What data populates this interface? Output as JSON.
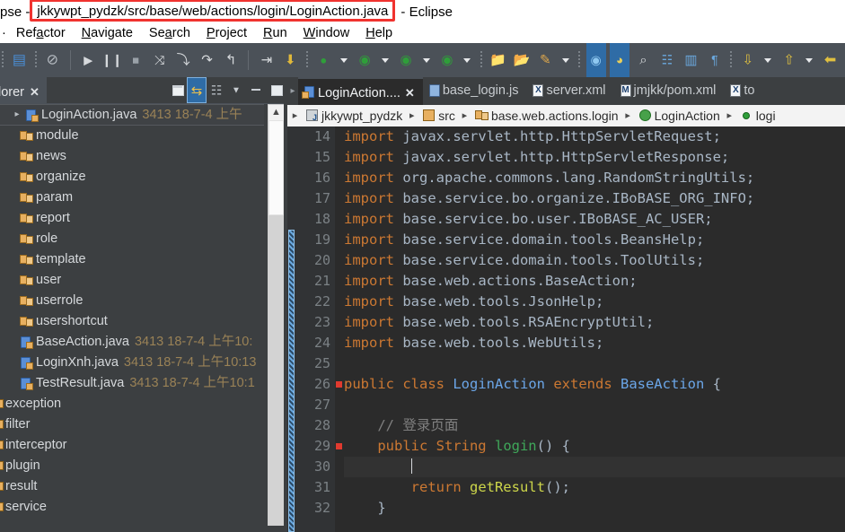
{
  "window": {
    "title_prefix": "pse -",
    "title_highlighted": "jkkywpt_pydzk/src/base/web/actions/login/LoginAction.java",
    "title_suffix": "- Eclipse",
    "highlight_color": "#f0332f"
  },
  "menubar": {
    "items": [
      {
        "pre": "",
        "mn": "",
        "post": "·"
      },
      {
        "pre": "Ref",
        "mn": "a",
        "post": "ctor"
      },
      {
        "pre": "",
        "mn": "N",
        "post": "avigate"
      },
      {
        "pre": "Se",
        "mn": "a",
        "post": "rch"
      },
      {
        "pre": "",
        "mn": "P",
        "post": "roject"
      },
      {
        "pre": "",
        "mn": "R",
        "post": "un"
      },
      {
        "pre": "",
        "mn": "W",
        "post": "indow"
      },
      {
        "pre": "",
        "mn": "H",
        "post": "elp"
      }
    ]
  },
  "toolbar": {
    "groups": [
      {
        "name": "save-group",
        "buttons": [
          {
            "name": "save-icon",
            "glyph": "▤",
            "color": "#3b7dbf",
            "selected": false
          },
          {
            "name": "save-all-icon",
            "glyph": "⊘",
            "color": "#c9ced3",
            "selected": false
          }
        ]
      },
      {
        "name": "debug-group",
        "buttons": [
          {
            "name": "resume-icon",
            "glyph": "▶",
            "color": "#c9ced3"
          },
          {
            "name": "suspend-icon",
            "glyph": "❙❙",
            "color": "#c9ced3"
          },
          {
            "name": "terminate-icon",
            "glyph": "■",
            "color": "#a8aeb4"
          },
          {
            "name": "disconnect-icon",
            "glyph": "⤨",
            "color": "#c9ced3"
          },
          {
            "name": "step-into-icon",
            "glyph": "⤵",
            "color": "#c9ced3"
          },
          {
            "name": "step-over-icon",
            "glyph": "↷",
            "color": "#c9ced3"
          },
          {
            "name": "step-return-icon",
            "glyph": "↰",
            "color": "#c9ced3"
          }
        ]
      },
      {
        "name": "build-group",
        "buttons": [
          {
            "name": "build-all-icon",
            "glyph": "⇥",
            "color": "#e8eaec"
          },
          {
            "name": "toggle-breakpoint-icon",
            "glyph": "⬇",
            "color": "#e0b83a"
          }
        ]
      },
      {
        "name": "run-group",
        "buttons": [
          {
            "name": "skip-breakpoints-icon",
            "glyph": "●",
            "color": "#2f9e3a"
          },
          {
            "name": "run-icon",
            "glyph": "▶",
            "color": "#2f9e3a"
          },
          {
            "name": "debug-icon",
            "glyph": "●",
            "color": "#2f9e3a"
          },
          {
            "name": "coverage-icon",
            "glyph": "●",
            "color": "#2f9e3a"
          }
        ]
      },
      {
        "name": "open-group",
        "buttons": [
          {
            "name": "new-java-project-icon",
            "glyph": "📁",
            "color": "#e8b060"
          },
          {
            "name": "open-folder-icon",
            "glyph": "📂",
            "color": "#e8b060"
          },
          {
            "name": "new-icon",
            "glyph": "✎",
            "color": "#e8b060"
          }
        ]
      },
      {
        "name": "perspective-group",
        "buttons": [
          {
            "name": "java-perspective-icon",
            "glyph": "◉",
            "color": "#5b9bd5",
            "selected": true
          },
          {
            "name": "javascript-perspective-icon",
            "glyph": "◗",
            "color": "#e0c040",
            "selected": true
          },
          {
            "name": "search-icon",
            "glyph": "⌕",
            "color": "#c9ced3"
          },
          {
            "name": "open-task-icon",
            "glyph": "☷",
            "color": "#5b9bd5"
          },
          {
            "name": "open-type-icon",
            "glyph": "▥",
            "color": "#5b9bd5"
          },
          {
            "name": "last-edit-icon",
            "glyph": "¶",
            "color": "#5b9bd5"
          }
        ]
      },
      {
        "name": "nav-group",
        "buttons": [
          {
            "name": "next-annotation-icon",
            "glyph": "↓",
            "color": "#e0c040"
          },
          {
            "name": "previous-annotation-icon",
            "glyph": "↑",
            "color": "#e0c040"
          },
          {
            "name": "back-icon",
            "glyph": "⇦",
            "color": "#e0c040"
          },
          {
            "name": "forward-back-icon",
            "glyph": "⇦",
            "color": "#e0c040"
          },
          {
            "name": "forward-icon",
            "glyph": "⇨",
            "color": "#e8eaec"
          }
        ]
      }
    ]
  },
  "explorer": {
    "tab_label": "lorer",
    "tab_close": "✕",
    "tools": [
      {
        "name": "collapse-all-icon",
        "glyph": "⊟",
        "active": false
      },
      {
        "name": "link-with-editor-icon",
        "glyph": "⇆",
        "active": true
      },
      {
        "name": "view-menu-icon",
        "glyph": "▽",
        "active": false
      }
    ],
    "min_label": "–",
    "max_label": "□",
    "items": [
      {
        "name": "LoginAction.java",
        "meta": "3413  18-7-4 上午",
        "icon": "java",
        "arrow": "▸",
        "selected": true,
        "indent": 0
      },
      {
        "name": "module",
        "meta": "",
        "icon": "package",
        "arrow": "",
        "selected": false,
        "indent": 1
      },
      {
        "name": "news",
        "meta": "",
        "icon": "package",
        "arrow": "",
        "selected": false,
        "indent": 1
      },
      {
        "name": "organize",
        "meta": "",
        "icon": "package",
        "arrow": "",
        "selected": false,
        "indent": 1
      },
      {
        "name": "param",
        "meta": "",
        "icon": "package",
        "arrow": "",
        "selected": false,
        "indent": 1
      },
      {
        "name": "report",
        "meta": "",
        "icon": "package",
        "arrow": "",
        "selected": false,
        "indent": 1
      },
      {
        "name": "role",
        "meta": "",
        "icon": "package",
        "arrow": "",
        "selected": false,
        "indent": 1
      },
      {
        "name": "template",
        "meta": "",
        "icon": "package",
        "arrow": "",
        "selected": false,
        "indent": 1
      },
      {
        "name": "user",
        "meta": "",
        "icon": "package",
        "arrow": "",
        "selected": false,
        "indent": 1
      },
      {
        "name": "userrole",
        "meta": "",
        "icon": "package",
        "arrow": "",
        "selected": false,
        "indent": 1
      },
      {
        "name": "usershortcut",
        "meta": "",
        "icon": "package",
        "arrow": "",
        "selected": false,
        "indent": 1
      },
      {
        "name": "BaseAction.java",
        "meta": "3413  18-7-4 上午10:",
        "icon": "java",
        "arrow": "",
        "selected": false,
        "indent": 1
      },
      {
        "name": "LoginXnh.java",
        "meta": "3413  18-7-4 上午10:13",
        "icon": "java",
        "arrow": "",
        "selected": false,
        "indent": 1
      },
      {
        "name": "TestResult.java",
        "meta": "3413  18-7-4 上午10:1",
        "icon": "java",
        "arrow": "",
        "selected": false,
        "indent": 1
      },
      {
        "name": "exception",
        "meta": "",
        "icon": "clipped",
        "arrow": "",
        "selected": false,
        "indent": 2
      },
      {
        "name": "filter",
        "meta": "",
        "icon": "clipped",
        "arrow": "",
        "selected": false,
        "indent": 2
      },
      {
        "name": "interceptor",
        "meta": "",
        "icon": "clipped",
        "arrow": "",
        "selected": false,
        "indent": 2
      },
      {
        "name": "plugin",
        "meta": "",
        "icon": "clipped",
        "arrow": "",
        "selected": false,
        "indent": 2
      },
      {
        "name": "result",
        "meta": "",
        "icon": "clipped",
        "arrow": "",
        "selected": false,
        "indent": 2
      },
      {
        "name": "service",
        "meta": "",
        "icon": "clipped",
        "arrow": "",
        "selected": false,
        "indent": 2
      }
    ]
  },
  "editor": {
    "tabs": [
      {
        "label": "LoginAction....",
        "icon": "java",
        "active": true,
        "closable": true
      },
      {
        "label": "base_login.js",
        "icon": "js",
        "active": false,
        "closable": false
      },
      {
        "label": "server.xml",
        "icon": "xml",
        "active": false,
        "closable": false
      },
      {
        "label": "jmjkk/pom.xml",
        "icon": "maven",
        "active": false,
        "closable": false
      },
      {
        "label": "to",
        "icon": "xml",
        "active": false,
        "closable": false
      }
    ],
    "breadcrumb": [
      {
        "label": "jkkywpt_pydzk",
        "icon": "project"
      },
      {
        "label": "src",
        "icon": "source-folder"
      },
      {
        "label": "base.web.actions.login",
        "icon": "package"
      },
      {
        "label": "LoginAction",
        "icon": "class"
      },
      {
        "label": "logi",
        "icon": "method"
      }
    ],
    "first_line_number": 14,
    "lines": [
      {
        "n": 14,
        "marker": false,
        "current": false,
        "tokens": [
          {
            "t": "import ",
            "c": "kw"
          },
          {
            "t": "javax.servlet.http.HttpServletRequest;",
            "c": "pl"
          }
        ]
      },
      {
        "n": 15,
        "marker": false,
        "current": false,
        "tokens": [
          {
            "t": "import ",
            "c": "kw"
          },
          {
            "t": "javax.servlet.http.HttpServletResponse;",
            "c": "pl"
          }
        ]
      },
      {
        "n": 16,
        "marker": false,
        "current": false,
        "tokens": [
          {
            "t": "import ",
            "c": "kw"
          },
          {
            "t": "org.apache.commons.lang.RandomStringUtils;",
            "c": "pl"
          }
        ]
      },
      {
        "n": 17,
        "marker": false,
        "current": false,
        "tokens": [
          {
            "t": "import ",
            "c": "kw"
          },
          {
            "t": "base.service.bo.organize.IBoBASE_ORG_INFO;",
            "c": "pl"
          }
        ]
      },
      {
        "n": 18,
        "marker": false,
        "current": false,
        "tokens": [
          {
            "t": "import ",
            "c": "kw"
          },
          {
            "t": "base.service.bo.user.IBoBASE_AC_USER;",
            "c": "pl"
          }
        ]
      },
      {
        "n": 19,
        "marker": false,
        "current": false,
        "tokens": [
          {
            "t": "import ",
            "c": "kw"
          },
          {
            "t": "base.service.domain.tools.BeansHelp;",
            "c": "pl"
          }
        ]
      },
      {
        "n": 20,
        "marker": false,
        "current": false,
        "tokens": [
          {
            "t": "import ",
            "c": "kw"
          },
          {
            "t": "base.service.domain.tools.ToolUtils;",
            "c": "pl"
          }
        ]
      },
      {
        "n": 21,
        "marker": false,
        "current": false,
        "tokens": [
          {
            "t": "import ",
            "c": "kw"
          },
          {
            "t": "base.web.actions.BaseAction;",
            "c": "pl"
          }
        ]
      },
      {
        "n": 22,
        "marker": false,
        "current": false,
        "tokens": [
          {
            "t": "import ",
            "c": "kw"
          },
          {
            "t": "base.web.tools.JsonHelp;",
            "c": "pl"
          }
        ]
      },
      {
        "n": 23,
        "marker": false,
        "current": false,
        "tokens": [
          {
            "t": "import ",
            "c": "kw"
          },
          {
            "t": "base.web.tools.RSAEncryptUtil;",
            "c": "pl"
          }
        ]
      },
      {
        "n": 24,
        "marker": false,
        "current": false,
        "tokens": [
          {
            "t": "import ",
            "c": "kw"
          },
          {
            "t": "base.web.tools.WebUtils;",
            "c": "pl"
          }
        ]
      },
      {
        "n": 25,
        "marker": false,
        "current": false,
        "tokens": []
      },
      {
        "n": 26,
        "marker": true,
        "current": false,
        "tokens": [
          {
            "t": "public class ",
            "c": "kw"
          },
          {
            "t": "LoginAction",
            "c": "cls"
          },
          {
            "t": " ",
            "c": "pl"
          },
          {
            "t": "extends ",
            "c": "kw"
          },
          {
            "t": "BaseAction",
            "c": "cls"
          },
          {
            "t": " {",
            "c": "pl"
          }
        ]
      },
      {
        "n": 27,
        "marker": false,
        "current": false,
        "tokens": []
      },
      {
        "n": 28,
        "marker": false,
        "current": false,
        "tokens": [
          {
            "t": "    // 登录页面",
            "c": "cm"
          }
        ]
      },
      {
        "n": 29,
        "marker": true,
        "current": false,
        "tokens": [
          {
            "t": "    ",
            "c": "pl"
          },
          {
            "t": "public String ",
            "c": "kw"
          },
          {
            "t": "login",
            "c": "mth"
          },
          {
            "t": "() {",
            "c": "pl"
          }
        ]
      },
      {
        "n": 30,
        "marker": false,
        "current": true,
        "tokens": [
          {
            "t": "        ",
            "c": "pl"
          }
        ]
      },
      {
        "n": 31,
        "marker": false,
        "current": false,
        "tokens": [
          {
            "t": "        ",
            "c": "pl"
          },
          {
            "t": "return ",
            "c": "kw"
          },
          {
            "t": "getResult",
            "c": "mth2"
          },
          {
            "t": "();",
            "c": "pl"
          }
        ]
      },
      {
        "n": 32,
        "marker": false,
        "current": false,
        "tokens": [
          {
            "t": "    }",
            "c": "pl"
          }
        ]
      }
    ]
  }
}
